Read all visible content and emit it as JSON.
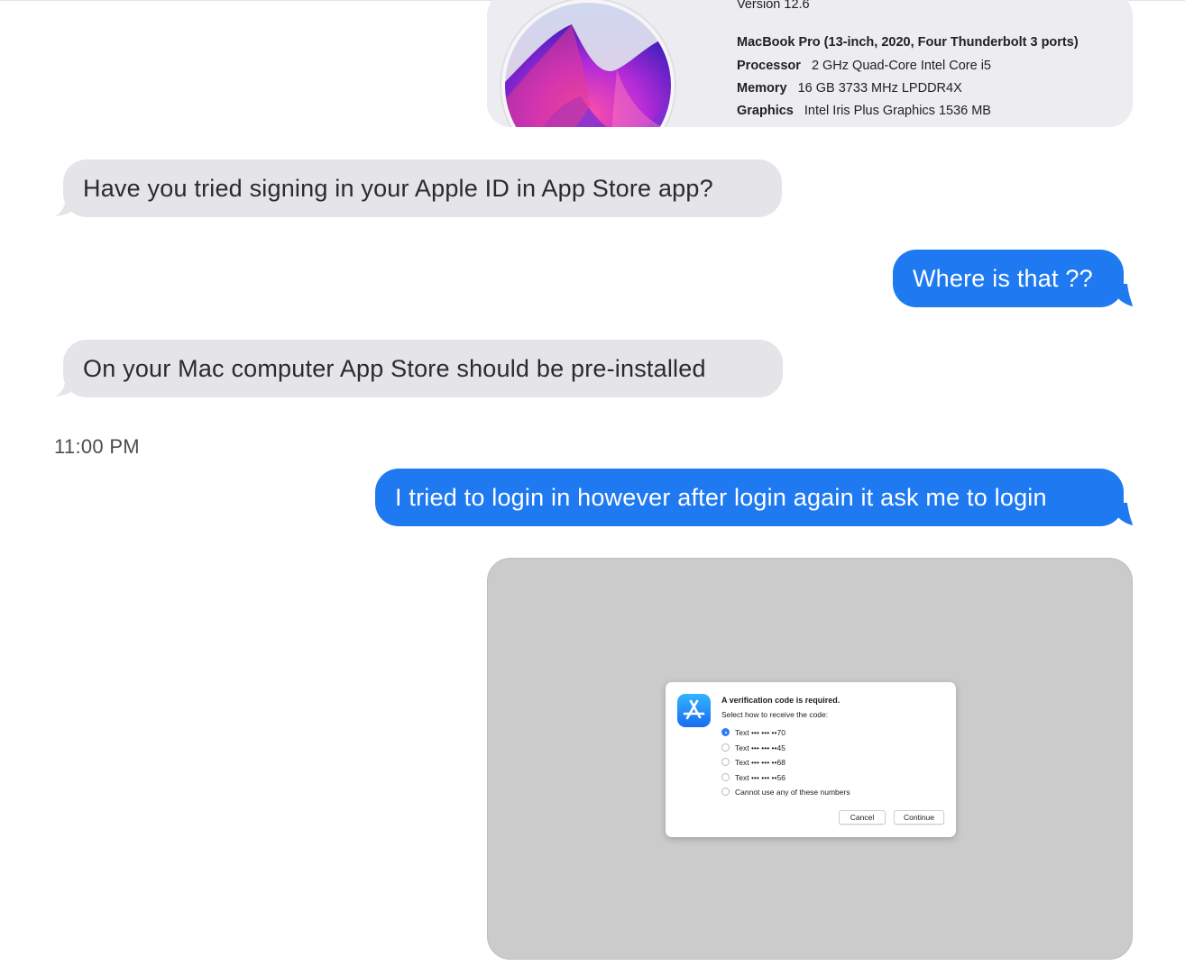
{
  "about_mac": {
    "version": "Version 12.6",
    "model": "MacBook Pro (13-inch, 2020, Four Thunderbolt 3 ports)",
    "specs": [
      {
        "label": "Processor",
        "value": "2 GHz Quad-Core Intel Core i5"
      },
      {
        "label": "Memory",
        "value": "16 GB 3733 MHz LPDDR4X"
      },
      {
        "label": "Graphics",
        "value": "Intel Iris Plus Graphics 1536 MB"
      }
    ]
  },
  "messages": [
    {
      "direction": "received",
      "text": "Have you tried signing in your Apple ID in App Store app?"
    },
    {
      "direction": "sent",
      "text": "Where is that ??"
    },
    {
      "direction": "received",
      "text": "On your Mac computer App Store should be pre-installed"
    },
    {
      "direction": "sent",
      "text": "I tried to login in however after login again it ask me to login"
    }
  ],
  "timestamp": "11:00 PM",
  "dialog": {
    "title": "A verification code is required.",
    "subtitle": "Select how to receive the code:",
    "options": [
      {
        "label": "Text ••• ••• ••70",
        "selected": true
      },
      {
        "label": "Text ••• ••• ••45",
        "selected": false
      },
      {
        "label": "Text ••• ••• ••68",
        "selected": false
      },
      {
        "label": "Text ••• ••• ••56",
        "selected": false
      },
      {
        "label": "Cannot use any of these numbers",
        "selected": false
      }
    ],
    "cancel_label": "Cancel",
    "continue_label": "Continue"
  },
  "colors": {
    "sent_bubble": "#1f7af1",
    "received_bubble": "#e4e4e9",
    "screenshot_bg": "#cbcbcb"
  },
  "icons": [
    "macos-monterey-logo",
    "app-store-icon"
  ]
}
